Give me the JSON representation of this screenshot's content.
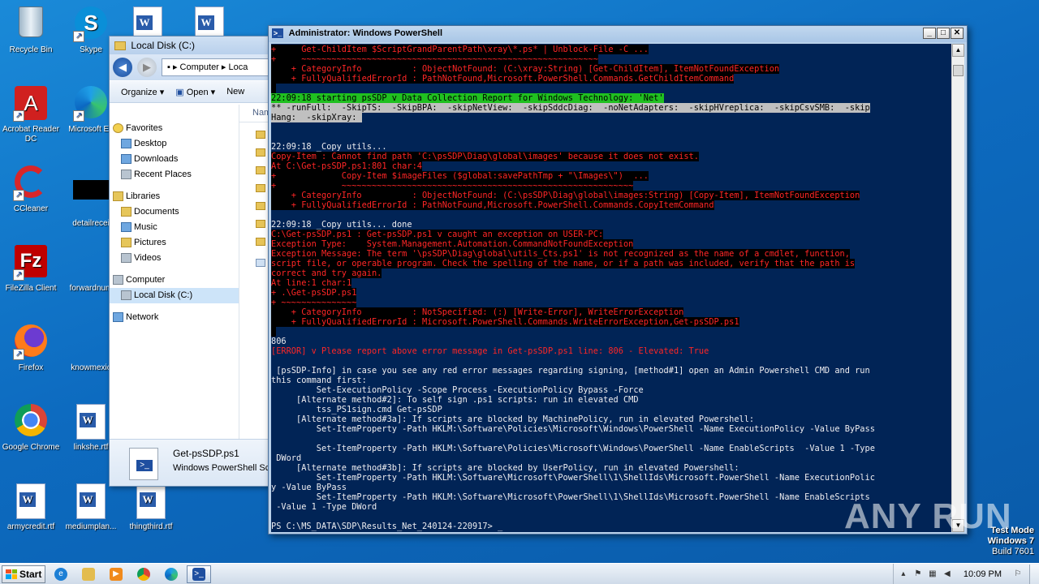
{
  "desktop": {
    "icons": [
      {
        "label": "Recycle Bin",
        "icon": "recycle-bin-icon"
      },
      {
        "label": "Skype",
        "icon": "skype-icon"
      },
      {
        "label": "Acrobat Reader DC",
        "icon": "acrobat-icon"
      },
      {
        "label": "Microsoft Ed",
        "icon": "edge-icon"
      },
      {
        "label": "CCleaner",
        "icon": "ccleaner-icon"
      },
      {
        "label": "detailrecei",
        "icon": "blank-file-icon"
      },
      {
        "label": "FileZilla Client",
        "icon": "filezilla-icon"
      },
      {
        "label": "forwardnum",
        "icon": "blank-file-icon"
      },
      {
        "label": "Firefox",
        "icon": "firefox-icon"
      },
      {
        "label": "knowmexic",
        "icon": "blank-file-icon"
      },
      {
        "label": "Google Chrome",
        "icon": "chrome-icon"
      },
      {
        "label": "linkshe.rtf",
        "icon": "word-doc-icon"
      },
      {
        "label": "armycredit.rtf",
        "icon": "word-doc-icon"
      },
      {
        "label": "mediumplan...",
        "icon": "word-doc-icon"
      },
      {
        "label": "thingthird.rtf",
        "icon": "word-doc-icon"
      }
    ]
  },
  "explorer": {
    "title": "Local Disk (C:)",
    "address": [
      "Computer",
      "Loca"
    ],
    "toolbar": {
      "organize": "Organize",
      "open": "Open",
      "new": "New"
    },
    "nav": {
      "favorites": "Favorites",
      "desktop": "Desktop",
      "downloads": "Downloads",
      "recent": "Recent Places",
      "libraries": "Libraries",
      "documents": "Documents",
      "music": "Music",
      "pictures": "Pictures",
      "videos": "Videos",
      "computer": "Computer",
      "localdisk": "Local Disk (C:)",
      "network": "Network"
    },
    "column_header": "Nam",
    "details": {
      "name": "Get-psSDP.ps1",
      "type": "Windows PowerShell Scr"
    }
  },
  "powershell": {
    "title": "Administrator: Windows PowerShell",
    "lines": [
      {
        "t": "+     Get-ChildItem $ScriptGrandParentPath\\xray\\*.ps* | Unblock-File -C ...",
        "c": "err"
      },
      {
        "t": "+     ~~~~~~~~~~~~~~~~~~~~~~~~~~~~~~~~~~~~~~~~~~~~~~~~~~~~~~~~~~~",
        "c": "err"
      },
      {
        "t": "    + CategoryInfo          : ObjectNotFound: (C:\\xray:String) [Get-ChildItem], ItemNotFoundException",
        "c": "err"
      },
      {
        "t": "    + FullyQualifiedErrorId : PathNotFound,Microsoft.PowerShell.Commands.GetChildItemCommand",
        "c": "err"
      },
      {
        "t": " ",
        "c": "err"
      },
      {
        "t": "22:09:18 starting psSDP v Data Collection Report for Windows Technology: 'Net'",
        "c": "grn"
      },
      {
        "t": "** -runFull:  -SkipTS:  -SkipBPA:  -skipNetView:  -skipSddcDiag:  -noNetAdapters:  -skipHVreplica:  -skipCsvSMB:  -skip",
        "c": "hl"
      },
      {
        "t": "Hang:  -skipXray: ",
        "c": "hl"
      },
      {
        "t": "",
        "c": "wht"
      },
      {
        "t": "",
        "c": "wht"
      },
      {
        "t": "22:09:18 _Copy utils...",
        "c": "wht"
      },
      {
        "t": "Copy-Item : Cannot find path 'C:\\psSDP\\Diag\\global\\images' because it does not exist.",
        "c": "err"
      },
      {
        "t": "At C:\\Get-psSDP.ps1:801 char:4",
        "c": "err"
      },
      {
        "t": "+             Copy-Item $imageFiles ($global:savePathTmp + \"\\Images\\\")  ...",
        "c": "err"
      },
      {
        "t": "+             ~~~~~~~~~~~~~~~~~~~~~~~~~~~~~~~~~~~~~~~~~~~~~~~~~~~~~~~~~~",
        "c": "err"
      },
      {
        "t": "    + CategoryInfo          : ObjectNotFound: (C:\\psSDP\\Diag\\global\\images:String) [Copy-Item], ItemNotFoundException",
        "c": "err"
      },
      {
        "t": "    + FullyQualifiedErrorId : PathNotFound,Microsoft.PowerShell.Commands.CopyItemCommand",
        "c": "err"
      },
      {
        "t": "",
        "c": "wht"
      },
      {
        "t": "22:09:18 _Copy utils... done",
        "c": "wht"
      },
      {
        "t": "C:\\Get-psSDP.ps1 : Get-psSDP.ps1 v caught an exception on USER-PC:",
        "c": "err"
      },
      {
        "t": "Exception Type:    System.Management.Automation.CommandNotFoundException",
        "c": "err"
      },
      {
        "t": "Exception Message: The term '\\psSDP\\Diag\\global\\utils_Cts.ps1' is not recognized as the name of a cmdlet, function,",
        "c": "err"
      },
      {
        "t": "script file, or operable program. Check the spelling of the name, or if a path was included, verify that the path is",
        "c": "err"
      },
      {
        "t": "correct and try again.",
        "c": "err"
      },
      {
        "t": "At line:1 char:1",
        "c": "err"
      },
      {
        "t": "+ .\\Get-psSDP.ps1",
        "c": "err"
      },
      {
        "t": "+ ~~~~~~~~~~~~~~~",
        "c": "err"
      },
      {
        "t": "    + CategoryInfo          : NotSpecified: (:) [Write-Error], WriteErrorException",
        "c": "err"
      },
      {
        "t": "    + FullyQualifiedErrorId : Microsoft.PowerShell.Commands.WriteErrorException,Get-psSDP.ps1",
        "c": "err"
      },
      {
        "t": " ",
        "c": "err"
      },
      {
        "t": "806",
        "c": "wht"
      },
      {
        "t": "[ERROR] v Please report above error message in Get-psSDP.ps1 line: 806 - Elevated: True",
        "c": "errd"
      },
      {
        "t": "",
        "c": "wht"
      },
      {
        "t": " [psSDP-Info] in case you see any red error messages regarding signing, [method#1] open an Admin Powershell CMD and run",
        "c": "wht"
      },
      {
        "t": "this command first:",
        "c": "wht"
      },
      {
        "t": "         Set-ExecutionPolicy -Scope Process -ExecutionPolicy Bypass -Force",
        "c": "wht"
      },
      {
        "t": "     [Alternate method#2]: To self sign .ps1 scripts: run in elevated CMD",
        "c": "wht"
      },
      {
        "t": "         tss_PS1sign.cmd Get-psSDP",
        "c": "wht"
      },
      {
        "t": "     [Alternate method#3a]: If scripts are blocked by MachinePolicy, run in elevated Powershell:",
        "c": "wht"
      },
      {
        "t": "         Set-ItemProperty -Path HKLM:\\Software\\Policies\\Microsoft\\Windows\\PowerShell -Name ExecutionPolicy -Value ByPass",
        "c": "wht"
      },
      {
        "t": "",
        "c": "wht"
      },
      {
        "t": "         Set-ItemProperty -Path HKLM:\\Software\\Policies\\Microsoft\\Windows\\PowerShell -Name EnableScripts  -Value 1 -Type",
        "c": "wht"
      },
      {
        "t": " DWord",
        "c": "wht"
      },
      {
        "t": "     [Alternate method#3b]: If scripts are blocked by UserPolicy, run in elevated Powershell:",
        "c": "wht"
      },
      {
        "t": "         Set-ItemProperty -Path HKLM:\\Software\\Microsoft\\PowerShell\\1\\ShellIds\\Microsoft.PowerShell -Name ExecutionPolic",
        "c": "wht"
      },
      {
        "t": "y -Value ByPass",
        "c": "wht"
      },
      {
        "t": "         Set-ItemProperty -Path HKLM:\\Software\\Microsoft\\PowerShell\\1\\ShellIds\\Microsoft.PowerShell -Name EnableScripts",
        "c": "wht"
      },
      {
        "t": " -Value 1 -Type DWord",
        "c": "wht"
      },
      {
        "t": "",
        "c": "wht"
      },
      {
        "t": "PS C:\\MS_DATA\\SDP\\Results_Net_240124-220917> _",
        "c": "wht"
      }
    ]
  },
  "watermark": "ANY RUN",
  "testmode": {
    "line1": "Test Mode",
    "line2": "Windows 7",
    "line3": "Build 7601"
  },
  "taskbar": {
    "start": "Start",
    "clock": "10:09 PM"
  }
}
